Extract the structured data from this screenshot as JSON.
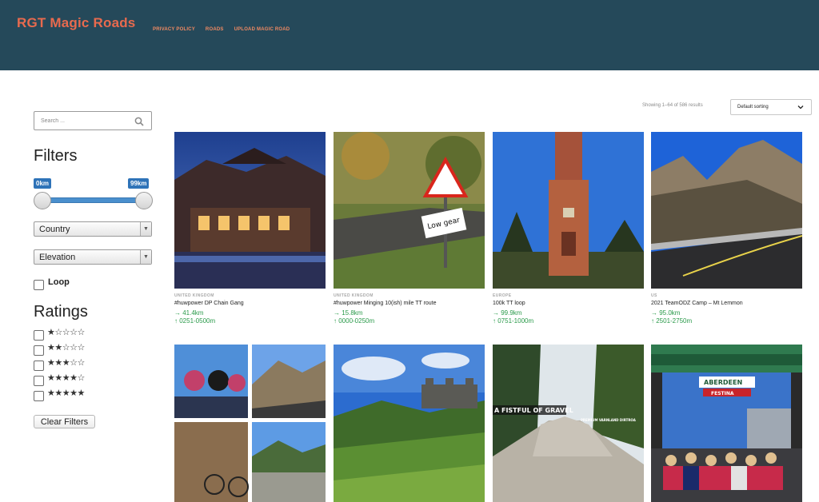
{
  "header": {
    "logo": "RGT Magic Roads",
    "nav": [
      "PRIVACY POLICY",
      "ROADS",
      "UPLOAD MAGIC ROAD"
    ],
    "background": "#25495a",
    "accent": "#e86a4e"
  },
  "search": {
    "placeholder": "Search ...",
    "value": "",
    "icon": "search-icon"
  },
  "filters": {
    "title": "Filters",
    "range": {
      "min_label": "0km",
      "max_label": "99km",
      "min": 0,
      "max": 99
    },
    "country": "Country",
    "elevation": "Elevation",
    "loop_label": "Loop"
  },
  "ratings": {
    "title": "Ratings",
    "rows": [
      "★☆☆☆☆",
      "★★☆☆☆",
      "★★★☆☆",
      "★★★★☆",
      "★★★★★"
    ],
    "levels": [
      1,
      2,
      3,
      4,
      5
    ]
  },
  "clear_button": "Clear Filters",
  "results": {
    "count_text": "Showing 1–64 of 586 results",
    "sort_value": "Default sorting"
  },
  "products": [
    {
      "country": "UNITED KINGDOM",
      "title": "#huwpower DP Chain Gang",
      "distance": "→ 41.4km",
      "elevation": "↑ 0251-0500m"
    },
    {
      "country": "UNITED KINGDOM",
      "title": "#huwpower Minging 10(ish) mile TT route",
      "distance": "→ 15.8km",
      "elevation": "↑ 0000-0250m"
    },
    {
      "country": "EUROPE",
      "title": "100k TT loop",
      "distance": "→ 99.9km",
      "elevation": "↑ 0751-1000m"
    },
    {
      "country": "US",
      "title": "2021 TeamODZ Camp – Mt Lemmon",
      "distance": "→ 95.0km",
      "elevation": "↑ 2501-2750m"
    }
  ],
  "row2_images": {
    "gravel_text": "A FISTFUL OF GRAVEL",
    "gravel_subtext": "PREMIUM VARNLAND DIRTROA",
    "arch_text": "ABERDEEN",
    "arch_subtext": "FESTINA"
  }
}
